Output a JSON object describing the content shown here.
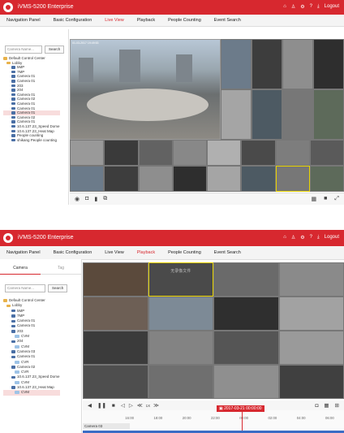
{
  "top": {
    "app_title": "iVMS-5200 Enterprise",
    "logout_label": "Logout",
    "menu": [
      "Navigation Panel",
      "Basic Configuration",
      "Live View",
      "Playback",
      "People Counting",
      "Event Search"
    ],
    "active_menu": "Live View",
    "search": {
      "placeholder": "Camera Name...",
      "button": "Search"
    },
    "tree": [
      {
        "label": "Default Control Center",
        "type": "folder"
      },
      {
        "label": "Lobby",
        "type": "folder"
      },
      {
        "label": "5MP",
        "type": "cam"
      },
      {
        "label": "7MP",
        "type": "cam"
      },
      {
        "label": "Camera 01",
        "type": "cam"
      },
      {
        "label": "Camera 01",
        "type": "cam"
      },
      {
        "label": "203",
        "type": "cam"
      },
      {
        "label": "204",
        "type": "cam"
      },
      {
        "label": "Camera 01",
        "type": "cam"
      },
      {
        "label": "Camera 02",
        "type": "cam"
      },
      {
        "label": "Camera 01",
        "type": "cam"
      },
      {
        "label": "Camera 01",
        "type": "cam"
      },
      {
        "label": "Camera 01",
        "type": "cam",
        "selected": true
      },
      {
        "label": "Camera 02",
        "type": "cam"
      },
      {
        "label": "Camera 01",
        "type": "cam"
      },
      {
        "label": "10.6.137.23_Speed Dome",
        "type": "cam"
      },
      {
        "label": "10.6.137.23_Heat Map",
        "type": "cam"
      },
      {
        "label": "People counting",
        "type": "cam"
      },
      {
        "label": "shikang People counting",
        "type": "cam"
      }
    ],
    "main_overlay_text": "01-03-2017 19:49:53"
  },
  "bottom": {
    "app_title": "iVMS-5200 Enterprise",
    "logout_label": "Logout",
    "menu": [
      "Navigation Panel",
      "Basic Configuration",
      "Live View",
      "Playback",
      "People Counting",
      "Event Search"
    ],
    "active_menu": "Playback",
    "tabs": [
      "Camera",
      "Tag"
    ],
    "search": {
      "placeholder": "Camera Name...",
      "button": "Search"
    },
    "tree": [
      {
        "label": "Default Control Center",
        "type": "folder"
      },
      {
        "label": "Lobby",
        "type": "folder"
      },
      {
        "label": "5MP",
        "type": "cam"
      },
      {
        "label": "7MP",
        "type": "cam"
      },
      {
        "label": "Camera 01",
        "type": "cam"
      },
      {
        "label": "Camera 01",
        "type": "cam"
      },
      {
        "label": "203",
        "type": "cam"
      },
      {
        "label": "CVM",
        "type": "ch"
      },
      {
        "label": "204",
        "type": "cam"
      },
      {
        "label": "CVM",
        "type": "ch"
      },
      {
        "label": "Camera 03",
        "type": "cam"
      },
      {
        "label": "Camera 01",
        "type": "cam"
      },
      {
        "label": "CVR",
        "type": "ch"
      },
      {
        "label": "Camera 02",
        "type": "cam"
      },
      {
        "label": "CVR",
        "type": "ch"
      },
      {
        "label": "10.6.137.23_Speed Dome",
        "type": "cam"
      },
      {
        "label": "CVM",
        "type": "ch"
      },
      {
        "label": "10.6.137.23_Heat Map",
        "type": "cam"
      },
      {
        "label": "CVM",
        "type": "ch",
        "selected": true
      }
    ],
    "no_video_text": "无录像文件",
    "speed_label": "1X",
    "timeline": {
      "date": "2017-03-21 00:00:00",
      "ticks": [
        "16:00",
        "18:00",
        "20:00",
        "22:00",
        "00:00",
        "02:00",
        "04:00",
        "06:00"
      ],
      "camera_row": "Camera 03"
    }
  }
}
